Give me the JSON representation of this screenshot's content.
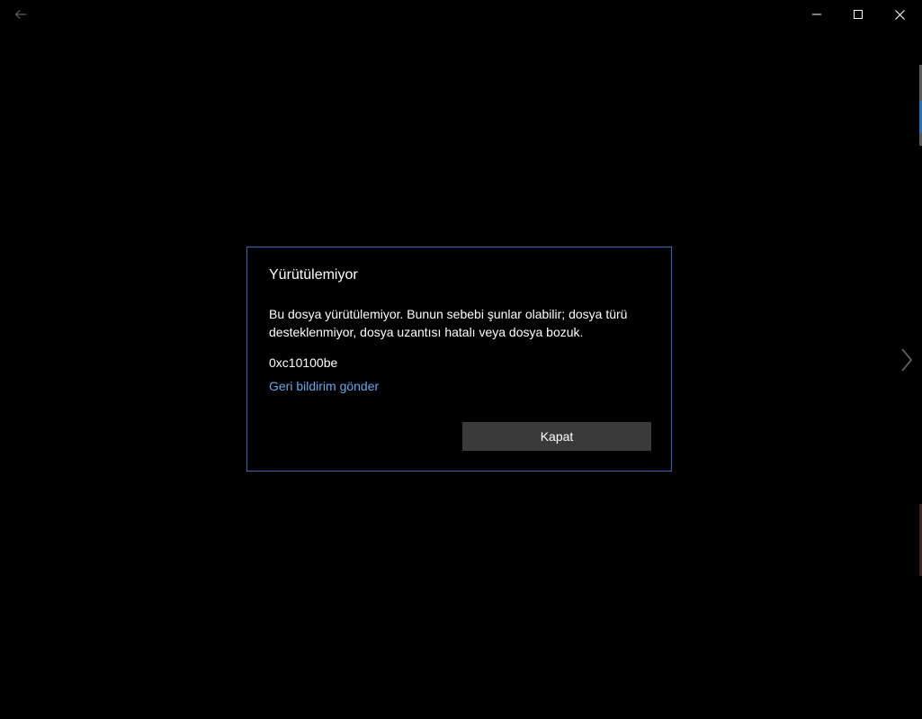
{
  "titlebar": {
    "back_icon": "back-arrow-icon",
    "minimize_icon": "minimize-icon",
    "maximize_icon": "maximize-icon",
    "close_icon": "close-icon"
  },
  "navigation": {
    "next_icon": "chevron-right-icon"
  },
  "dialog": {
    "title": "Yürütülemiyor",
    "message": "Bu dosya yürütülemiyor. Bunun sebebi şunlar olabilir; dosya türü desteklenmiyor, dosya uzantısı hatalı veya dosya bozuk.",
    "error_code": "0xc10100be",
    "feedback_link": "Geri bildirim gönder",
    "close_label": "Kapat"
  },
  "colors": {
    "background": "#000000",
    "dialog_border": "#3e64a8",
    "link": "#6aa6e8",
    "button_bg": "#3a3a3a",
    "text": "#ffffff"
  }
}
